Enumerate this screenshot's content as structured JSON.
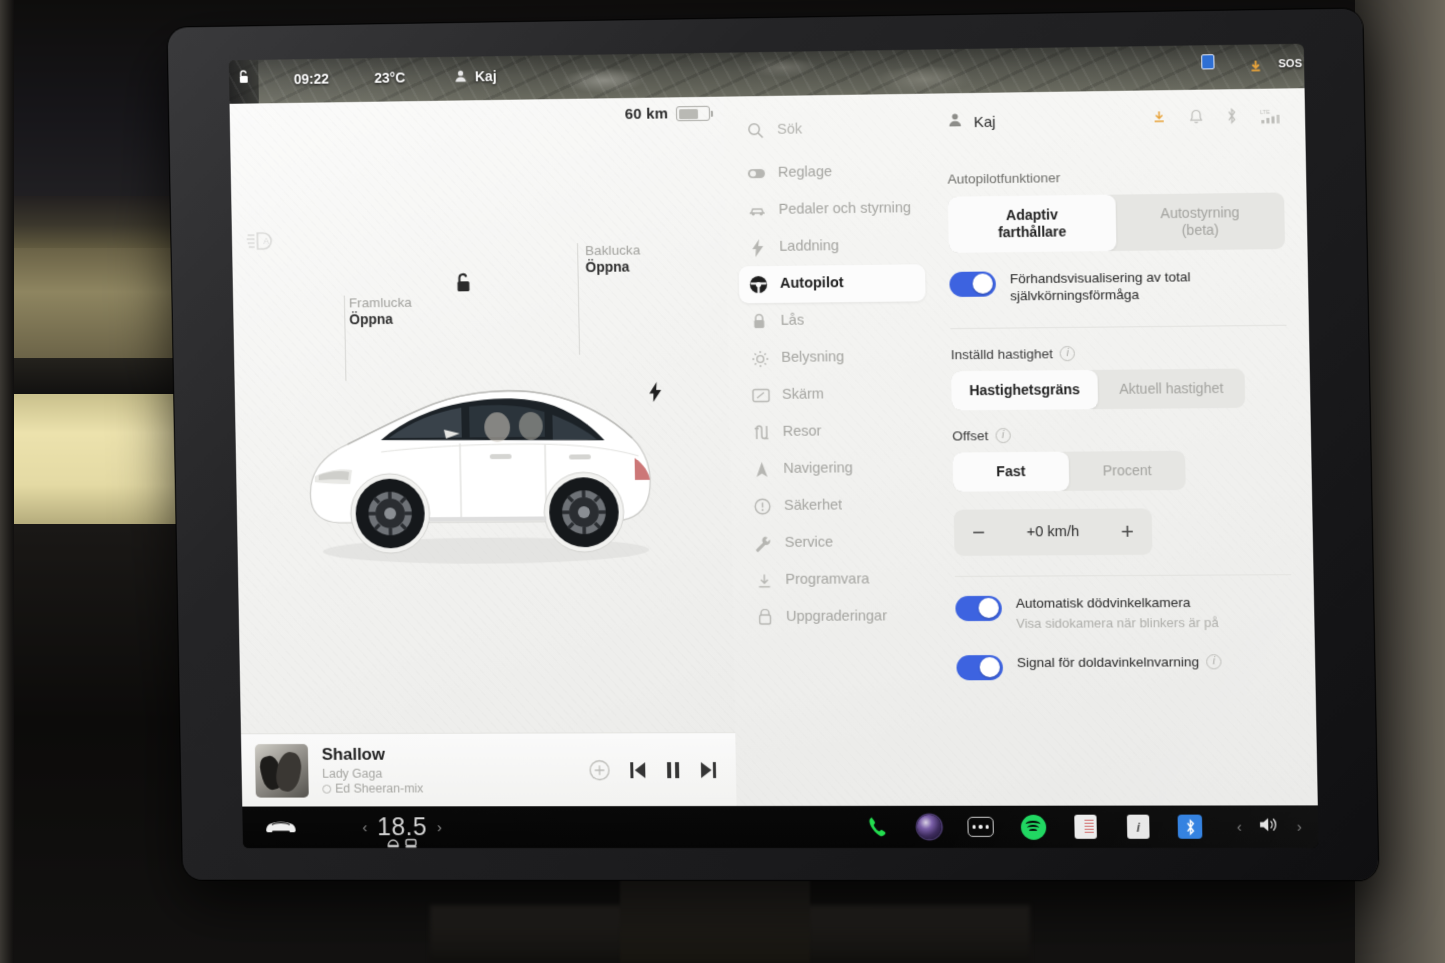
{
  "status_strip": {
    "unlock_icon": "unlock-icon",
    "time": "09:22",
    "temperature": "23°C",
    "driver_icon": "person-icon",
    "driver_name": "Kaj",
    "marker_icon": "map-marker-icon",
    "download_icon": "download-arrow-icon",
    "sos_label": "SOS"
  },
  "car_view": {
    "range_value": "60 km",
    "battery_icon": "battery-icon",
    "auto_headlight_icon": "auto-headlight-icon",
    "lock_icon": "unlocked-padlock-icon",
    "charge_port_icon": "charge-bolt-icon",
    "front_trunk": {
      "title": "Framlucka",
      "action": "Öppna"
    },
    "rear_trunk": {
      "title": "Baklucka",
      "action": "Öppna"
    }
  },
  "media_player": {
    "album_art": "album-art",
    "title": "Shallow",
    "artist": "Lady Gaga",
    "source": "Ed Sheeran-mix",
    "add_icon": "add-circle-icon",
    "prev_icon": "previous-track-icon",
    "pause_icon": "pause-icon",
    "next_icon": "next-track-icon"
  },
  "sidebar": {
    "search_label": "Sök",
    "search_icon": "search-icon",
    "items": [
      {
        "label": "Reglage",
        "icon": "toggle-icon",
        "active": false
      },
      {
        "label": "Pedaler och styrning",
        "icon": "car-icon",
        "active": false
      },
      {
        "label": "Laddning",
        "icon": "bolt-icon",
        "active": false
      },
      {
        "label": "Autopilot",
        "icon": "steering-wheel-icon",
        "active": true
      },
      {
        "label": "Lås",
        "icon": "lock-icon",
        "active": false
      },
      {
        "label": "Belysning",
        "icon": "sun-icon",
        "active": false
      },
      {
        "label": "Skärm",
        "icon": "display-icon",
        "active": false
      },
      {
        "label": "Resor",
        "icon": "trips-icon",
        "active": false
      },
      {
        "label": "Navigering",
        "icon": "navigation-icon",
        "active": false
      },
      {
        "label": "Säkerhet",
        "icon": "warning-icon",
        "active": false
      },
      {
        "label": "Service",
        "icon": "wrench-icon",
        "active": false
      },
      {
        "label": "Programvara",
        "icon": "download-icon",
        "active": false
      },
      {
        "label": "Uppgraderingar",
        "icon": "upgrade-icon",
        "active": false
      }
    ]
  },
  "account": {
    "avatar_icon": "person-icon",
    "name": "Kaj",
    "icons": [
      "download-icon",
      "bell-icon",
      "bluetooth-icon",
      "lte-signal-icon"
    ]
  },
  "autopilot": {
    "section_title": "Autopilotfunktioner",
    "mode_tabs": [
      {
        "label_line1": "Adaptiv",
        "label_line2": "farthållare",
        "selected": true
      },
      {
        "label_line1": "Autostyrning",
        "label_line2": "(beta)",
        "selected": false
      }
    ],
    "fsd_preview": {
      "enabled": true,
      "label_line1": "Förhandsvisualisering av total",
      "label_line2": "självkörningsförmåga"
    },
    "set_speed": {
      "label": "Inställd hastighet",
      "info_icon": "info-icon",
      "options": [
        {
          "label": "Hastighetsgräns",
          "selected": true
        },
        {
          "label": "Aktuell hastighet",
          "selected": false
        }
      ]
    },
    "offset": {
      "label": "Offset",
      "info_icon": "info-icon",
      "options": [
        {
          "label": "Fast",
          "selected": true
        },
        {
          "label": "Procent",
          "selected": false
        }
      ],
      "stepper": {
        "minus": "−",
        "value": "+0 km/h",
        "plus": "+"
      }
    },
    "blind_spot_camera": {
      "enabled": true,
      "title": "Automatisk dödvinkelkamera",
      "subtitle": "Visa sidokamera när blinkers är på"
    },
    "blind_spot_warning": {
      "enabled": true,
      "title": "Signal för doldavinkelnvarning",
      "info_icon": "info-icon"
    }
  },
  "dock": {
    "car_icon": "car-front-icon",
    "climate": {
      "decrease_icon": "chevron-left-icon",
      "temperature": "18.5",
      "increase_icon": "chevron-right-icon",
      "defrost_front_icon": "defrost-front-icon",
      "defrost_rear_icon": "defrost-rear-icon"
    },
    "apps": [
      {
        "name": "phone-icon"
      },
      {
        "name": "camera-icon"
      },
      {
        "name": "more-apps-icon"
      },
      {
        "name": "spotify-icon"
      },
      {
        "name": "calendar-icon"
      },
      {
        "name": "info-card-icon"
      },
      {
        "name": "bluetooth-icon"
      }
    ],
    "volume": {
      "decrease_icon": "chevron-left-icon",
      "speaker_icon": "speaker-icon",
      "increase_icon": "chevron-right-icon"
    }
  },
  "colors": {
    "toggle_on": "#3d63e0",
    "spotify_green": "#1ed760",
    "bluetooth_blue": "#2f7fe0",
    "download_orange": "#e8a33a"
  }
}
